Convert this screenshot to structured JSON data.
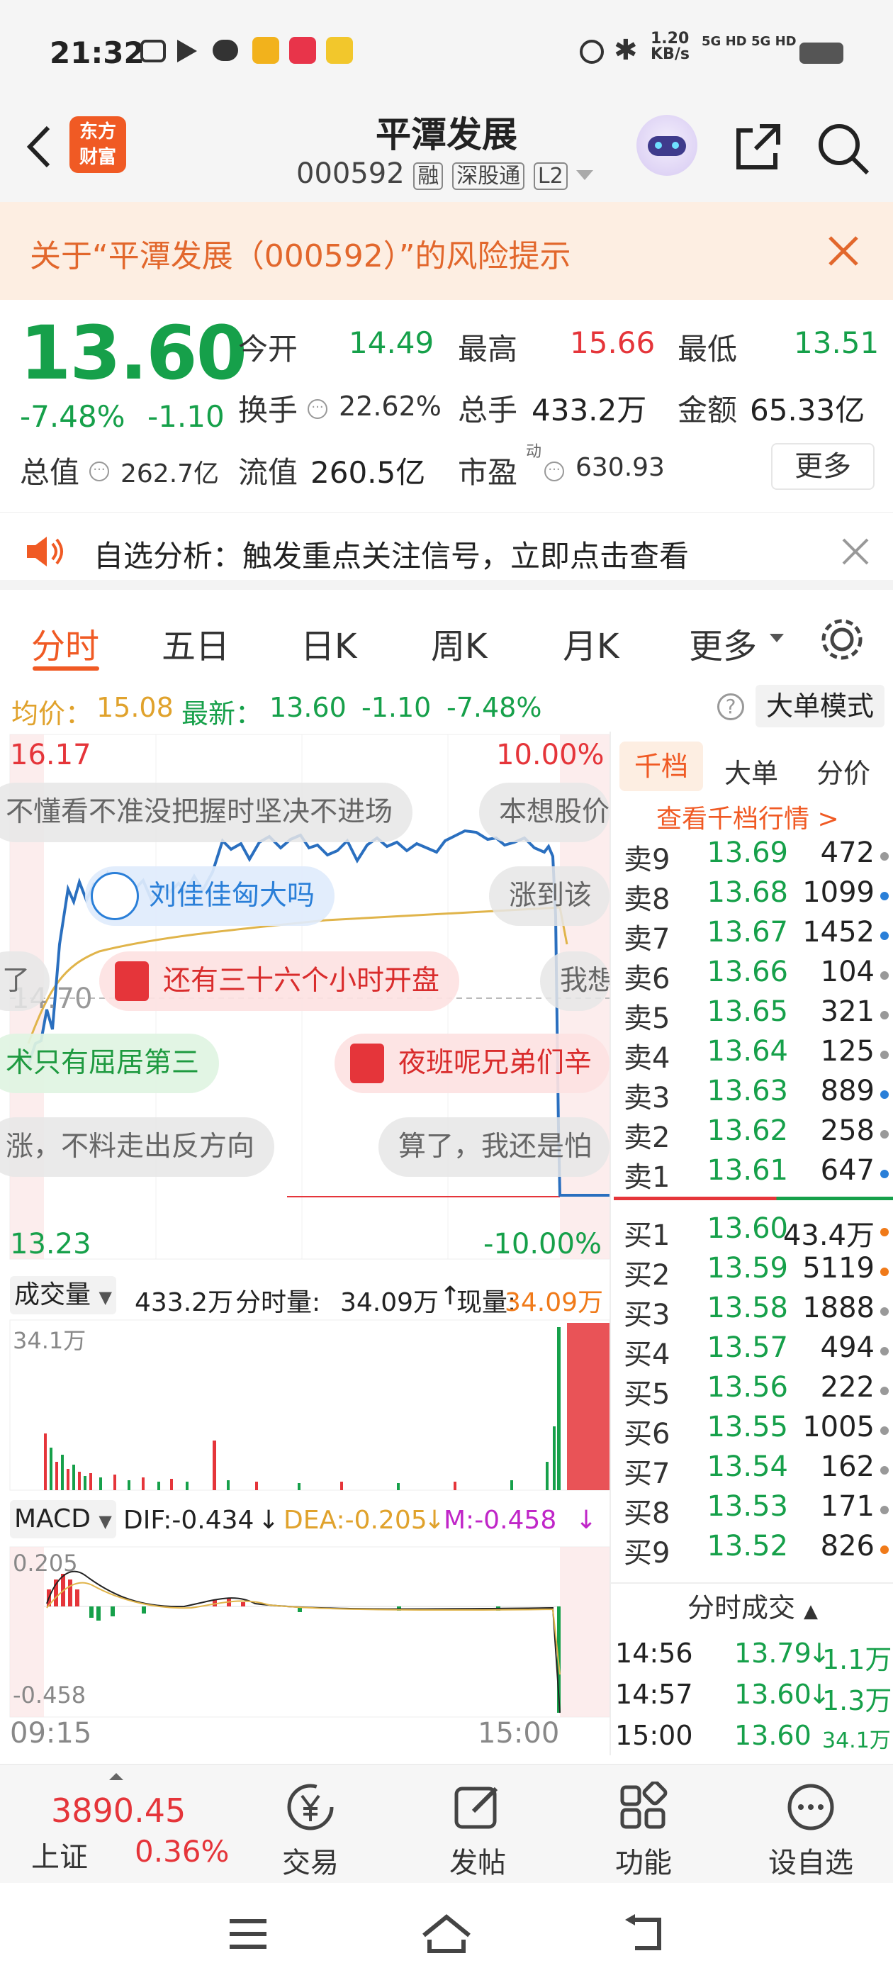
{
  "status_bar": {
    "time": "21:32",
    "net_speed_top": "1.20",
    "net_speed_unit": "KB/s",
    "sig1": "5G HD",
    "sig2": "5G HD",
    "app_icons": [
      "camera-icon",
      "play-icon",
      "chat-icon",
      "stock-app-icon",
      "xhs-icon",
      "yuanbao-icon"
    ]
  },
  "header": {
    "back_icon": "chevron-left-icon",
    "logo_line1": "东方",
    "logo_line2": "财富",
    "title": "平潭发展",
    "code": "000592",
    "tag_rong": "融",
    "tag_sgt": "深股通",
    "tag_l2": "L2",
    "robot_icon": "robot-avatar-icon",
    "share_icon": "share-icon",
    "search_icon": "search-icon"
  },
  "risk_banner": {
    "text": "关于“平潭发展（000592）”的风险提示",
    "close_icon": "close-icon"
  },
  "quote": {
    "price": "13.60",
    "change_pct": "-7.48%",
    "change": "-1.10",
    "open_label": "今开",
    "open": "14.49",
    "high_label": "最高",
    "high": "15.66",
    "low_label": "最低",
    "low": "13.51",
    "turnover_label": "换手",
    "turnover": "22.62%",
    "volume_label": "总手",
    "volume": "433.2万",
    "amount_label": "金额",
    "amount": "65.33亿",
    "mktcap_label": "总值",
    "mktcap": "262.7亿",
    "float_label": "流值",
    "float": "260.5亿",
    "pe_label": "市盈",
    "pe_sup": "动",
    "pe": "630.93",
    "more_button": "更多"
  },
  "notice": {
    "text": "自选分析：触发重点关注信号，立即点击查看",
    "speaker_icon": "speaker-icon",
    "close_icon": "close-icon"
  },
  "tabs": {
    "items": [
      "分时",
      "五日",
      "日K",
      "周K",
      "月K",
      "更多"
    ],
    "active": 0,
    "settings_icon": "gear-icon"
  },
  "avg_line": {
    "avg_label": "均价：",
    "avg": "15.08",
    "latest_label": "最新：",
    "latest": "13.60",
    "chg": "-1.10",
    "pct": "-7.48%",
    "help_icon": "help-circle-icon",
    "big_order_button": "大单模式"
  },
  "price_chart": {
    "top_left": "16.17",
    "top_right": "10.00%",
    "bottom_left": "13.23",
    "bottom_right": "-10.00%",
    "mid_label": "14.70"
  },
  "danmu": [
    {
      "text": "不懂看不准没把握时坚决不进场",
      "style": "gray"
    },
    {
      "text": "本想股价",
      "style": "gray"
    },
    {
      "text": "刘佳佳匈大吗",
      "style": "blue"
    },
    {
      "text": "涨到该",
      "style": "gray"
    },
    {
      "text": "了",
      "style": "gray"
    },
    {
      "text": "还有三十六个小时开盘",
      "style": "red"
    },
    {
      "text": "我想",
      "style": "gray"
    },
    {
      "text": "术只有屈居第三",
      "style": "green"
    },
    {
      "text": "夜班呢兄弟们辛",
      "style": "red"
    },
    {
      "text": "涨，不料走出反方向",
      "style": "gray"
    },
    {
      "text": "算了，我还是怕",
      "style": "gray"
    }
  ],
  "volume_bar": {
    "label": "成交量",
    "total": "433.2万",
    "fenshi_label": "分时量:",
    "fenshi": "34.09万",
    "arrow": "↑",
    "now_label": "现量:",
    "now": "34.09万",
    "max": "34.1万"
  },
  "macd": {
    "label": "MACD",
    "dif": "DIF:-0.434",
    "dif_arrow": "↓",
    "dea": "DEA:-0.205",
    "dea_arrow": "↓",
    "m": "M:-0.458",
    "m_arrow": "↓",
    "top": "0.205",
    "bottom": "-0.458"
  },
  "time_axis": {
    "start": "09:15",
    "end": "15:00"
  },
  "book": {
    "tabs": [
      "千档",
      "大单",
      "分价"
    ],
    "link": "查看千档行情 >",
    "asks": [
      {
        "label": "卖9",
        "price": "13.69",
        "vol": "472",
        "dot": "#999999"
      },
      {
        "label": "卖8",
        "price": "13.68",
        "vol": "1099",
        "dot": "#2a7fd8"
      },
      {
        "label": "卖7",
        "price": "13.67",
        "vol": "1452",
        "dot": "#2a7fd8"
      },
      {
        "label": "卖6",
        "price": "13.66",
        "vol": "104",
        "dot": "#999999"
      },
      {
        "label": "卖5",
        "price": "13.65",
        "vol": "321",
        "dot": "#999999"
      },
      {
        "label": "卖4",
        "price": "13.64",
        "vol": "125",
        "dot": "#999999"
      },
      {
        "label": "卖3",
        "price": "13.63",
        "vol": "889",
        "dot": "#2a7fd8"
      },
      {
        "label": "卖2",
        "price": "13.62",
        "vol": "258",
        "dot": "#999999"
      },
      {
        "label": "卖1",
        "price": "13.61",
        "vol": "647",
        "dot": "#2a7fd8"
      }
    ],
    "bids": [
      {
        "label": "买1",
        "price": "13.60",
        "vol": "43.4万",
        "dot": "#f07a19"
      },
      {
        "label": "买2",
        "price": "13.59",
        "vol": "5119",
        "dot": "#f07a19"
      },
      {
        "label": "买3",
        "price": "13.58",
        "vol": "1888",
        "dot": "#999999"
      },
      {
        "label": "买4",
        "price": "13.57",
        "vol": "494",
        "dot": "#999999"
      },
      {
        "label": "买5",
        "price": "13.56",
        "vol": "222",
        "dot": "#999999"
      },
      {
        "label": "买6",
        "price": "13.55",
        "vol": "1005",
        "dot": "#999999"
      },
      {
        "label": "买7",
        "price": "13.54",
        "vol": "162",
        "dot": "#999999"
      },
      {
        "label": "买8",
        "price": "13.53",
        "vol": "171",
        "dot": "#999999"
      },
      {
        "label": "买9",
        "price": "13.52",
        "vol": "826",
        "dot": "#f07a19"
      }
    ],
    "ticks_title": "分时成交",
    "ticks": [
      {
        "time": "14:56",
        "price": "13.79",
        "vol": "1.1万",
        "arrow": "↓"
      },
      {
        "time": "14:57",
        "price": "13.60",
        "vol": "1.3万",
        "arrow": "↓"
      },
      {
        "time": "15:00",
        "price": "13.60",
        "vol": "34.1万",
        "arrow": ""
      }
    ]
  },
  "bottom_bar": {
    "index_value": "3890.45",
    "index_name": "上证",
    "index_pct": "0.36%",
    "items": [
      {
        "label": "交易",
        "icon": "yen-circle-icon"
      },
      {
        "label": "发帖",
        "icon": "edit-icon"
      },
      {
        "label": "功能",
        "icon": "grid-icon"
      },
      {
        "label": "设自选",
        "icon": "more-circle-icon"
      }
    ]
  },
  "nav": {
    "menu_icon": "menu-icon",
    "home_icon": "home-icon",
    "back_icon": "back-icon"
  },
  "colors": {
    "up": "#e5353a",
    "down": "#16a04a",
    "accent": "#f07a19",
    "price_line": "#2a6fbf",
    "avg_line": "#e0b44a"
  }
}
